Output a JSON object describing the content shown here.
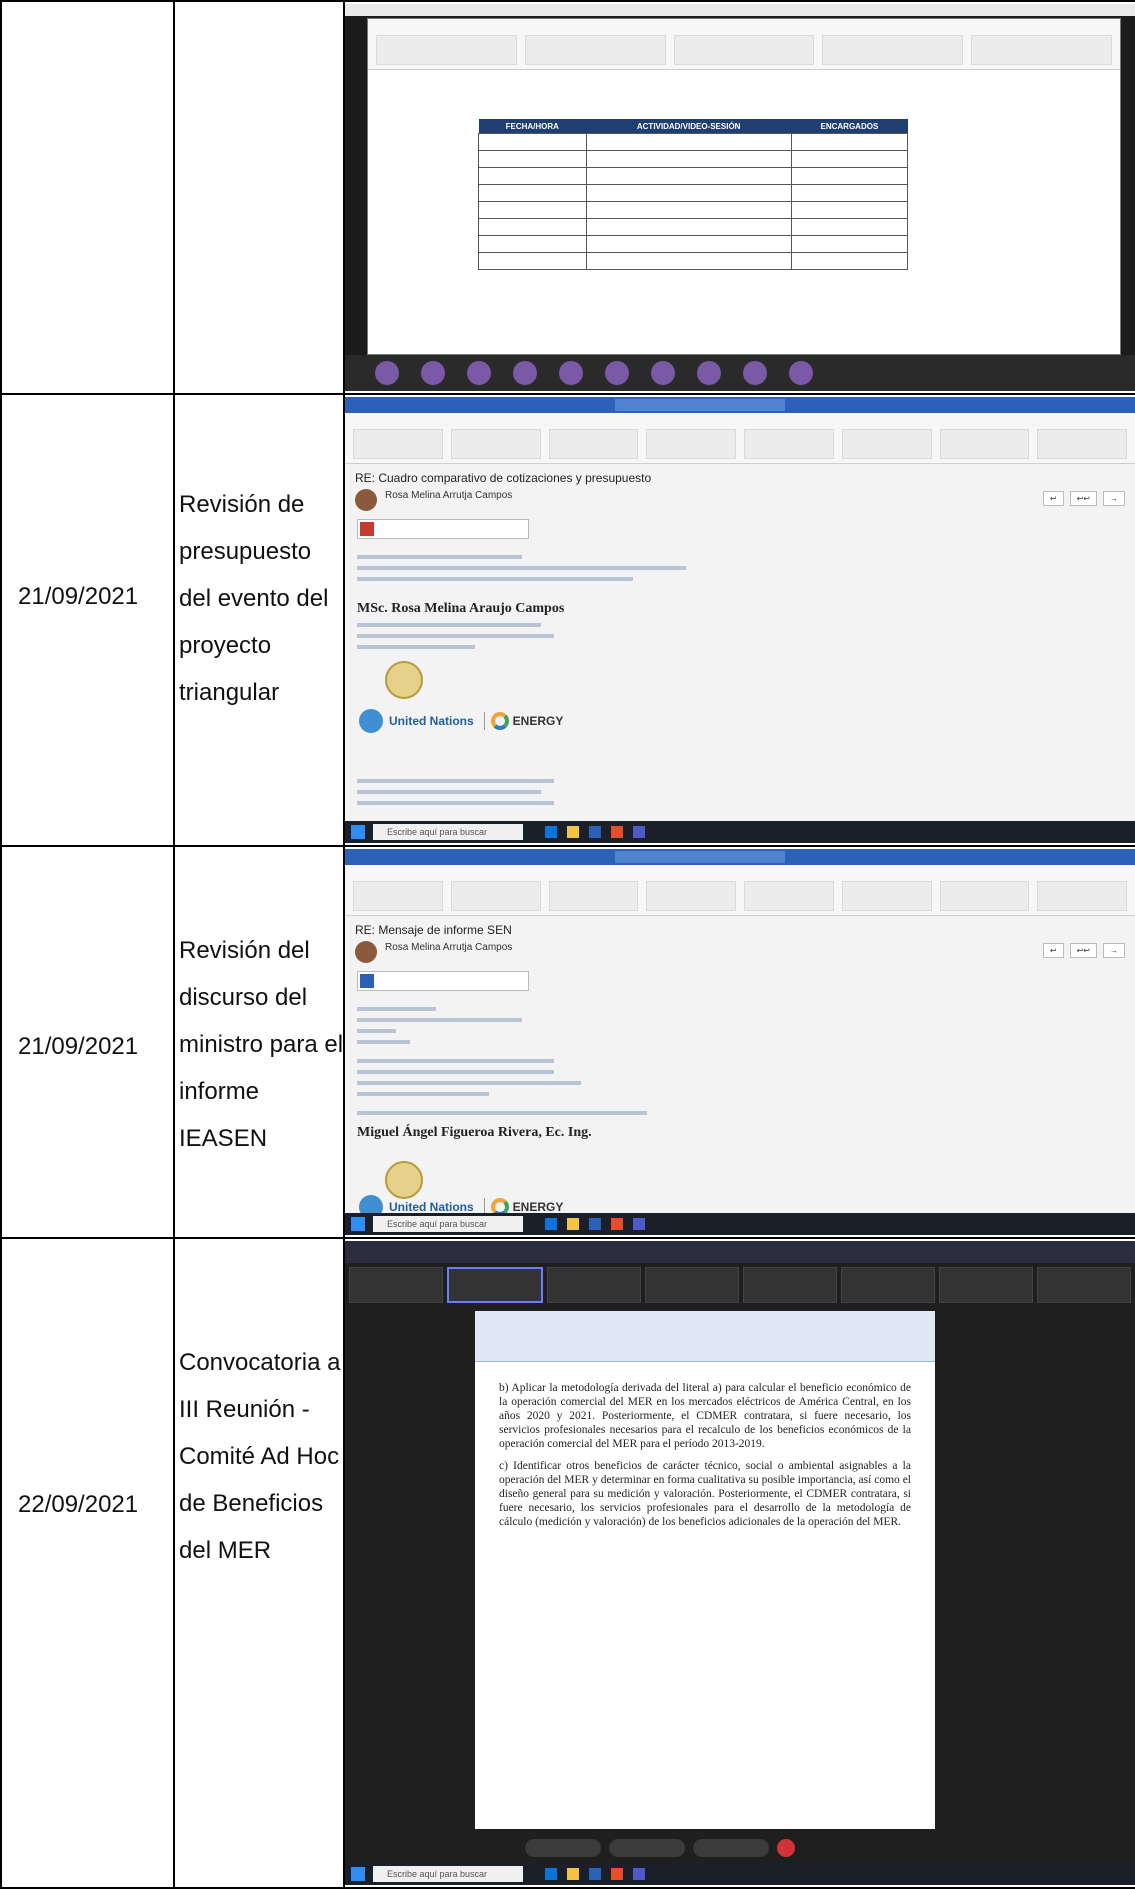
{
  "rows": [
    {
      "date": "",
      "activity": "",
      "screenshot": {
        "type": "video-meeting-schedule",
        "table_headers": [
          "FECHA/HORA",
          "ACTIVIDAD/VIDEO-SESIÓN",
          "ENCARGADOS"
        ]
      }
    },
    {
      "date": "21/09/2021",
      "activity": "Revisión de presupuesto del evento del proyecto triangular",
      "screenshot": {
        "type": "email",
        "subject": "RE: Cuadro comparativo de cotizaciones y presupuesto",
        "sender": "Rosa Melina Arrutja Campos",
        "signature_name": "MSc. Rosa Melina Araujo Campos",
        "logo_text": "United Nations",
        "logo_energy": "ENERGY",
        "search_placeholder": "Escribe aquí para buscar"
      }
    },
    {
      "date": "21/09/2021",
      "activity": "Revisión del discurso del ministro para el informe IEASEN",
      "screenshot": {
        "type": "email",
        "subject": "RE: Mensaje de informe SEN",
        "sender": "Rosa Melina Arrutja Campos",
        "signature_name": "Miguel Ángel Figueroa Rivera, Ec. Ing.",
        "logo_text": "United Nations",
        "logo_energy": "ENERGY",
        "search_placeholder": "Escribe aquí para buscar"
      }
    },
    {
      "date": "22/09/2021",
      "activity": "Convocatoria a III Reunión - Comité Ad Hoc de Beneficios del MER",
      "screenshot": {
        "type": "teams-meeting",
        "paragraph_b": "b) Aplicar la metodología derivada del literal a) para calcular el beneficio económico de la operación comercial del MER en los mercados eléctricos de América Central, en los años 2020 y 2021. Posteriormente, el CDMER contratara, si fuere necesario, los servicios profesionales necesarios para el recalculo de los beneficios económicos de la operación comercial del MER para el período 2013-2019.",
        "paragraph_c": "c) Identificar otros beneficios de carácter técnico, social o ambiental asignables a la operación del MER y determinar en forma cualitativa su posible importancia, así como el diseño general para su medición y valoración. Posteriormente, el CDMER contratara, si fuere necesario, los servicios profesionales para el desarrollo de la metodología de cálculo (medición y valoración) de los beneficios adicionales de la operación del MER.",
        "search_placeholder": "Escribe aquí para buscar"
      }
    }
  ]
}
